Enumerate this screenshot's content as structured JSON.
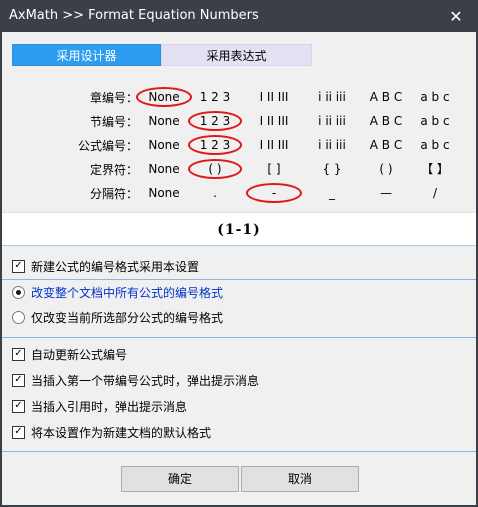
{
  "window": {
    "title": "AxMath >> Format Equation Numbers",
    "close_glyph": "✕"
  },
  "tabs": [
    {
      "label": "采用设计器",
      "active": true
    },
    {
      "label": "采用表达式",
      "active": false
    }
  ],
  "grid": {
    "rows": [
      {
        "label": "章编号：",
        "options": [
          "None",
          "1 2 3",
          "I II III",
          "i ii iii",
          "A B C",
          "a b c"
        ],
        "selected": 0
      },
      {
        "label": "节编号：",
        "options": [
          "None",
          "1 2 3",
          "I II III",
          "i ii iii",
          "A B C",
          "a b c"
        ],
        "selected": 1
      },
      {
        "label": "公式编号：",
        "options": [
          "None",
          "1 2 3",
          "I II III",
          "i ii iii",
          "A B C",
          "a b c"
        ],
        "selected": 1
      },
      {
        "label": "定界符：",
        "options": [
          "None",
          "(  )",
          "[  ]",
          "{  }",
          "(  )",
          "【  】"
        ],
        "selected": 1
      },
      {
        "label": "分隔符：",
        "options": [
          "None",
          ".",
          "-",
          "_",
          "—",
          "/"
        ],
        "selected": 2
      }
    ]
  },
  "preview": {
    "text": "(1-1)"
  },
  "group1": [
    {
      "type": "checkbox",
      "label": "新建公式的编号格式采用本设置",
      "checked": true
    }
  ],
  "group2": [
    {
      "type": "radio",
      "label": "改变整个文档中所有公式的编号格式",
      "checked": true,
      "highlight": true
    },
    {
      "type": "radio",
      "label": "仅改变当前所选部分公式的编号格式",
      "checked": false,
      "highlight": false
    }
  ],
  "group3": [
    {
      "type": "checkbox",
      "label": "自动更新公式编号",
      "checked": true
    },
    {
      "type": "checkbox",
      "label": "当插入第一个带编号公式时，弹出提示消息",
      "checked": true
    },
    {
      "type": "checkbox",
      "label": "当插入引用时，弹出提示消息",
      "checked": true
    },
    {
      "type": "checkbox",
      "label": "将本设置作为新建文档的默认格式",
      "checked": true
    }
  ],
  "buttons": {
    "ok": "确定",
    "cancel": "取消"
  },
  "colors": {
    "titlebar": "#3b3f46",
    "tab_active": "#2e9df0",
    "tab_inactive": "#e4e1f3",
    "selection_circle": "#e01818",
    "link_blue": "#0033cc"
  }
}
